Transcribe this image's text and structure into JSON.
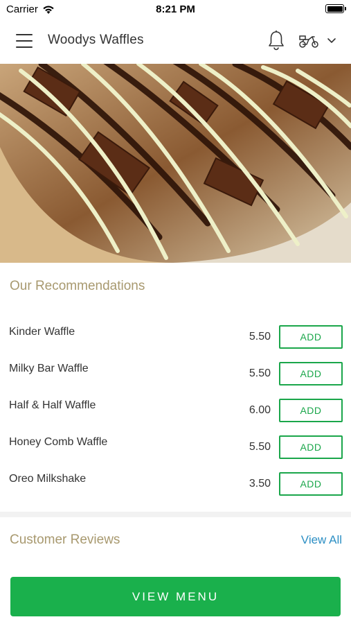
{
  "status_bar": {
    "carrier": "Carrier",
    "time": "8:21 PM"
  },
  "nav": {
    "title": "Woodys Waffles",
    "icons": [
      "menu-icon",
      "bell-icon",
      "scooter-icon",
      "chevron-down-icon"
    ]
  },
  "recommendations": {
    "title": "Our Recommendations",
    "items": [
      {
        "name": "Kinder Waffle",
        "price": "5.50",
        "button": "ADD"
      },
      {
        "name": "Milky Bar Waffle",
        "price": "5.50",
        "button": "ADD"
      },
      {
        "name": "Half & Half Waffle",
        "price": "6.00",
        "button": "ADD"
      },
      {
        "name": "Honey Comb Waffle",
        "price": "5.50",
        "button": "ADD"
      },
      {
        "name": "Oreo Milkshake",
        "price": "3.50",
        "button": "ADD"
      }
    ]
  },
  "reviews": {
    "title": "Customer Reviews",
    "view_all": "View All"
  },
  "cta": {
    "label": "VIEW MENU"
  },
  "colors": {
    "accent_green": "#1ab04c",
    "heading_gold": "#a8996f",
    "link_blue": "#2d8fc4"
  }
}
